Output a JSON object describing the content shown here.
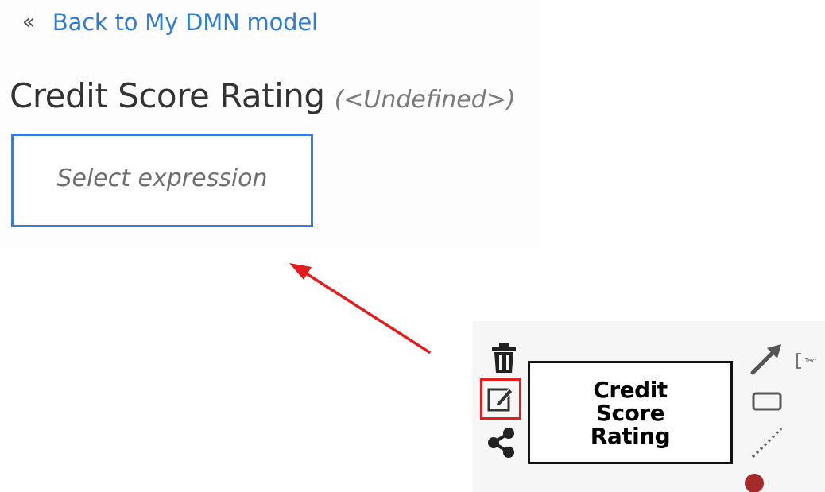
{
  "back_link": {
    "chevron": "«",
    "label": "Back to My DMN model"
  },
  "header": {
    "name": "Credit Score Rating",
    "type": "(<Undefined>)"
  },
  "expression_box": {
    "placeholder": "Select expression"
  },
  "diagram": {
    "node_label": "Credit Score Rating",
    "annotation_text": "Text",
    "left_toolbox": [
      "trash-icon",
      "edit-icon",
      "share-icon"
    ],
    "right_toolbox": [
      "connector-arrow-icon",
      "text-annotation-icon",
      "rectangle-icon",
      "dotted-connector-icon",
      "end-dot-icon"
    ]
  },
  "colors": {
    "link_blue": "#2f7cd6",
    "focus_border": "#3d7bd8",
    "highlight_red": "#e02020",
    "arrow_red": "#e21d1d",
    "dot_red": "#a52a2a"
  }
}
